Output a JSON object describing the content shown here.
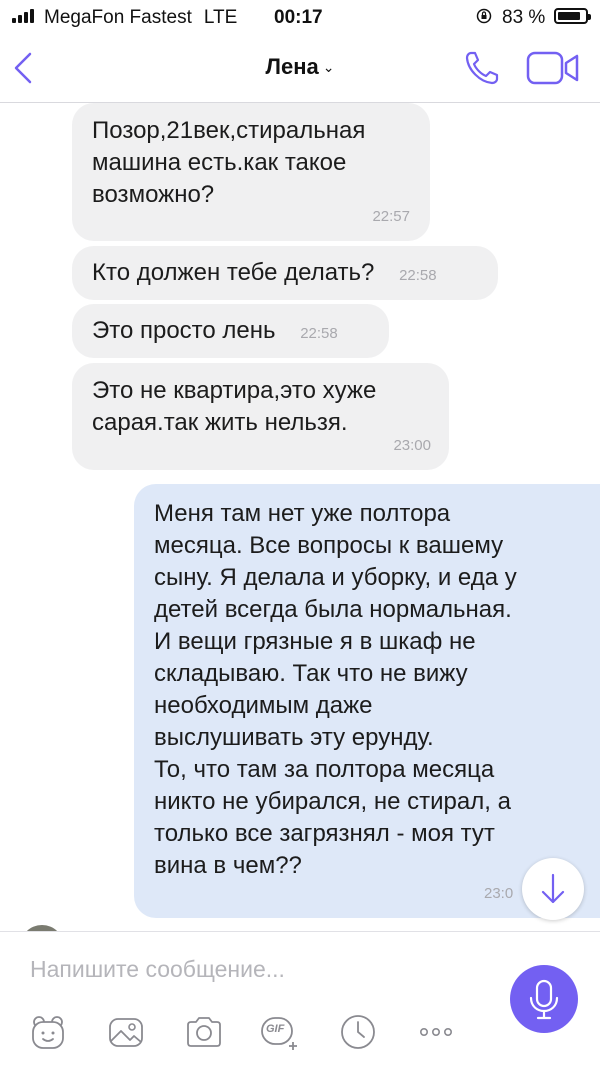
{
  "status_bar": {
    "carrier": "MegaFon Fastest",
    "network": "LTE",
    "time": "00:17",
    "battery": "83 %",
    "icons": [
      "signal-icon",
      "orientation-lock-icon",
      "battery-icon"
    ]
  },
  "header": {
    "contact_name": "Лена",
    "chevron": "⌄",
    "icons": [
      "back-icon",
      "phone-icon",
      "video-camera-icon"
    ]
  },
  "messages": [
    {
      "direction": "incoming",
      "lines": [
        "Позор,21век,стиральная",
        "машина есть.как такое",
        "возможно?"
      ],
      "time": "22:57"
    },
    {
      "direction": "incoming",
      "lines": [
        "Кто должен тебе делать?"
      ],
      "time": "22:58"
    },
    {
      "direction": "incoming",
      "lines": [
        "Это просто лень"
      ],
      "time": "22:58"
    },
    {
      "direction": "incoming",
      "lines": [
        "Это не квартира,это хуже",
        "сарая.так жить нельзя."
      ],
      "time": "23:00"
    },
    {
      "direction": "outgoing",
      "lines": [
        "Меня там нет уже полтора",
        "месяца. Все вопросы к вашему",
        "сыну. Я делала и уборку, и еда у",
        "детей всегда была нормальная.",
        "И вещи грязные я в шкаф не",
        "складываю. Так что не вижу",
        "необходимым даже",
        "выслушивать эту ерунду.",
        "То, что там за полтора месяца",
        "никто не убирался, не стирал, а",
        "только все загрязнял - моя тут",
        "вина в чем??"
      ],
      "time": "23:0"
    }
  ],
  "composer": {
    "placeholder": "Напишите сообщение...",
    "gif_label": "GIF",
    "icons": [
      "sticker-icon",
      "gallery-icon",
      "camera-icon",
      "gif-icon",
      "clock-icon",
      "more-icon",
      "microphone-icon",
      "scroll-down-icon"
    ]
  },
  "colors": {
    "accent": "#7360f2",
    "incoming_bubble": "#f0f0f1",
    "outgoing_bubble": "#dee8f8",
    "timestamp": "#a9a9ae"
  }
}
